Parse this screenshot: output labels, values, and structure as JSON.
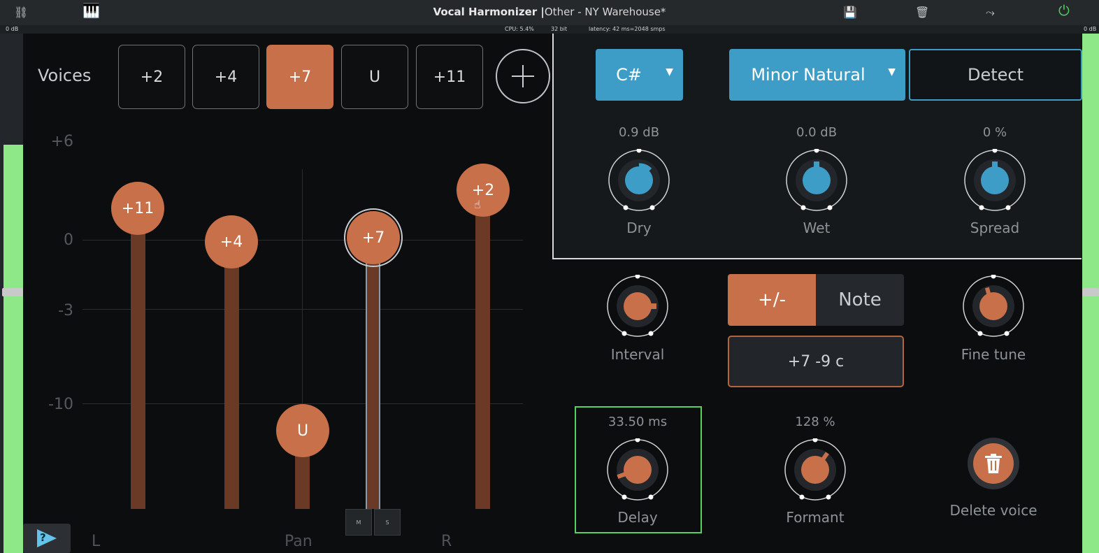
{
  "titlebar": {
    "title": "Vocal Harmonizer |",
    "subtitle": "Other - NY Warehouse*",
    "cpu": "CPU: 5.4%",
    "bits": "32 bit",
    "latency": "latency: 42 ms=2048 smps",
    "left_level": "0 dB",
    "right_level": "0 dB"
  },
  "voices": {
    "label": "Voices",
    "buttons": [
      "+2",
      "+4",
      "+7",
      "U",
      "+11"
    ],
    "selected": "+7"
  },
  "grid": {
    "labels": [
      "+6",
      "0",
      "-3",
      "-10"
    ],
    "axis": {
      "left": "L",
      "center": "Pan",
      "right": "R"
    },
    "handles": [
      "+11",
      "+4",
      "U",
      "+7",
      "+2"
    ],
    "mute": "M",
    "solo": "S",
    "help": "?"
  },
  "panel": {
    "key": "C#",
    "scale": "Minor Natural",
    "detect": "Detect",
    "dry": {
      "label": "Dry",
      "value": "0.9 dB"
    },
    "wet": {
      "label": "Wet",
      "value": "0.0 dB"
    },
    "spread": {
      "label": "Spread",
      "value": "0 %"
    }
  },
  "voice_controls": {
    "interval_label": "Interval",
    "toggle_plusminus": "+/-",
    "toggle_note": "Note",
    "interval_value": "+7 -9 c",
    "fine_tune_label": "Fine tune",
    "delay": {
      "label": "Delay",
      "value": "33.50 ms"
    },
    "formant": {
      "label": "Formant",
      "value": "128 %"
    },
    "delete_label": "Delete voice"
  },
  "colors": {
    "accent_orange": "#c8704a",
    "accent_blue": "#3e9dc6",
    "meter_green": "#8ee887",
    "focus_green": "#54d162"
  }
}
